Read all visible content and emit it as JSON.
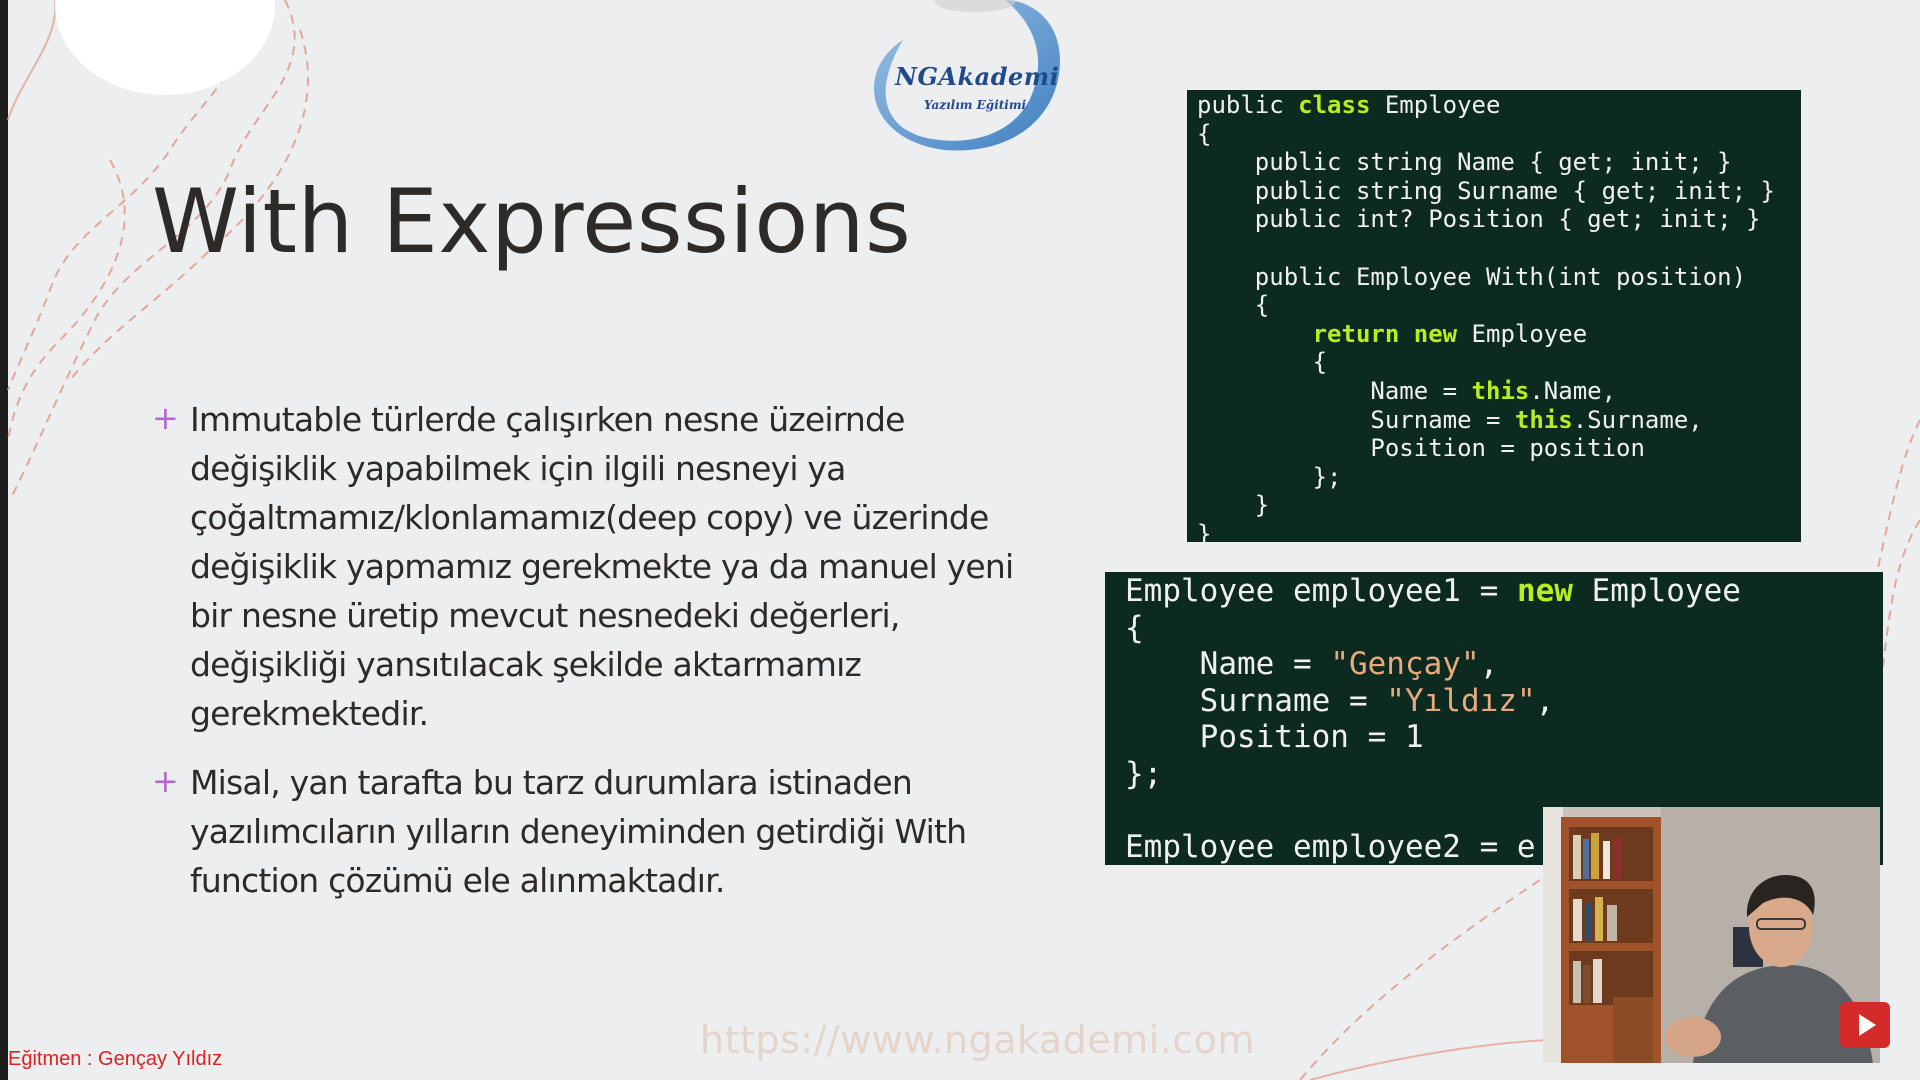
{
  "slide": {
    "title": "With Expressions",
    "bullets": [
      "Immutable türlerde çalışırken nesne üzeirnde değişiklik yapabilmek için ilgili nesneyi ya çoğaltmamız/klonlamamız(deep copy) ve üzerinde değişiklik yapmamız gerekmekte ya da manuel yeni bir nesne üretip mevcut nesnedeki değerleri, değişikliği yansıtılacak şekilde aktarmamız gerekmektedir.",
      "Misal, yan tarafta bu tarz durumlara istinaden yazılımcıların yılların deneyiminden getirdiği With function çözümü ele alınmaktadır."
    ]
  },
  "logo": {
    "name": "NGAkademi",
    "tagline": "Yazılım Eğitimi"
  },
  "code_blocks": [
    {
      "lines": [
        [
          {
            "t": "public "
          },
          {
            "t": "class",
            "k": "kw"
          },
          {
            "t": " Employee"
          }
        ],
        [
          {
            "t": "{"
          }
        ],
        [
          {
            "t": "    public string Name { get; init; }"
          }
        ],
        [
          {
            "t": "    public string Surname { get; init; }"
          }
        ],
        [
          {
            "t": "    public int? Position { get; init; }"
          }
        ],
        [
          {
            "t": ""
          }
        ],
        [
          {
            "t": "    public Employee With(int position)"
          }
        ],
        [
          {
            "t": "    {"
          }
        ],
        [
          {
            "t": "        "
          },
          {
            "t": "return",
            "k": "kw"
          },
          {
            "t": " "
          },
          {
            "t": "new",
            "k": "kw"
          },
          {
            "t": " Employee"
          }
        ],
        [
          {
            "t": "        {"
          }
        ],
        [
          {
            "t": "            Name = "
          },
          {
            "t": "this",
            "k": "kw"
          },
          {
            "t": ".Name,"
          }
        ],
        [
          {
            "t": "            Surname = "
          },
          {
            "t": "this",
            "k": "kw"
          },
          {
            "t": ".Surname,"
          }
        ],
        [
          {
            "t": "            Position = position"
          }
        ],
        [
          {
            "t": "        };"
          }
        ],
        [
          {
            "t": "    }"
          }
        ],
        [
          {
            "t": "}"
          }
        ]
      ]
    },
    {
      "lines": [
        [
          {
            "t": "Employee employee1 = "
          },
          {
            "t": "new",
            "k": "kw"
          },
          {
            "t": " Employee"
          }
        ],
        [
          {
            "t": "{"
          }
        ],
        [
          {
            "t": "    Name = "
          },
          {
            "t": "\"Gençay\"",
            "k": "str"
          },
          {
            "t": ","
          }
        ],
        [
          {
            "t": "    Surname = "
          },
          {
            "t": "\"Yıldız\"",
            "k": "str"
          },
          {
            "t": ","
          }
        ],
        [
          {
            "t": "    Position = 1"
          }
        ],
        [
          {
            "t": "};"
          }
        ],
        [
          {
            "t": ""
          }
        ],
        [
          {
            "t": "Employee employee2 = e"
          }
        ]
      ]
    }
  ],
  "watermark": "https://www.ngakademi.com",
  "instructor_label": "Eğitmen : Gençay Yıldız",
  "colors": {
    "background": "#eceeef",
    "code_background": "#0d2a20",
    "keyword": "#b7ee1f",
    "string": "#e8a97c",
    "bullet_plus": "#b269c9",
    "instructor_text": "#d8241f",
    "play_button": "#d42a2a"
  },
  "icons": [
    "plus-bullet-icon",
    "play-icon"
  ]
}
